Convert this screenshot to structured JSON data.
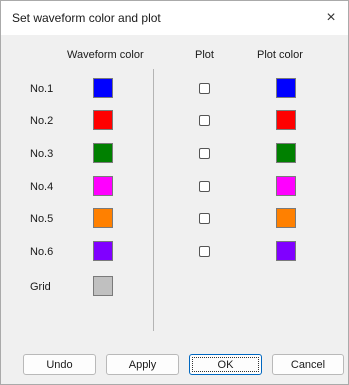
{
  "dialog": {
    "title": "Set waveform color and plot",
    "close_glyph": "×"
  },
  "headers": {
    "waveform_color": "Waveform color",
    "plot": "Plot",
    "plot_color": "Plot color"
  },
  "rows": [
    {
      "label": "No.1",
      "waveform_color": "#0000ff",
      "plot_checked": false,
      "plot_color": "#0000ff"
    },
    {
      "label": "No.2",
      "waveform_color": "#ff0000",
      "plot_checked": false,
      "plot_color": "#ff0000"
    },
    {
      "label": "No.3",
      "waveform_color": "#008000",
      "plot_checked": false,
      "plot_color": "#008000"
    },
    {
      "label": "No.4",
      "waveform_color": "#ff00ff",
      "plot_checked": false,
      "plot_color": "#ff00ff"
    },
    {
      "label": "No.5",
      "waveform_color": "#ff8000",
      "plot_checked": false,
      "plot_color": "#ff8000"
    },
    {
      "label": "No.6",
      "waveform_color": "#8000ff",
      "plot_checked": false,
      "plot_color": "#8000ff"
    }
  ],
  "grid": {
    "label": "Grid",
    "color": "#c0c0c0"
  },
  "buttons": {
    "undo": "Undo",
    "apply": "Apply",
    "ok": "OK",
    "cancel": "Cancel"
  }
}
